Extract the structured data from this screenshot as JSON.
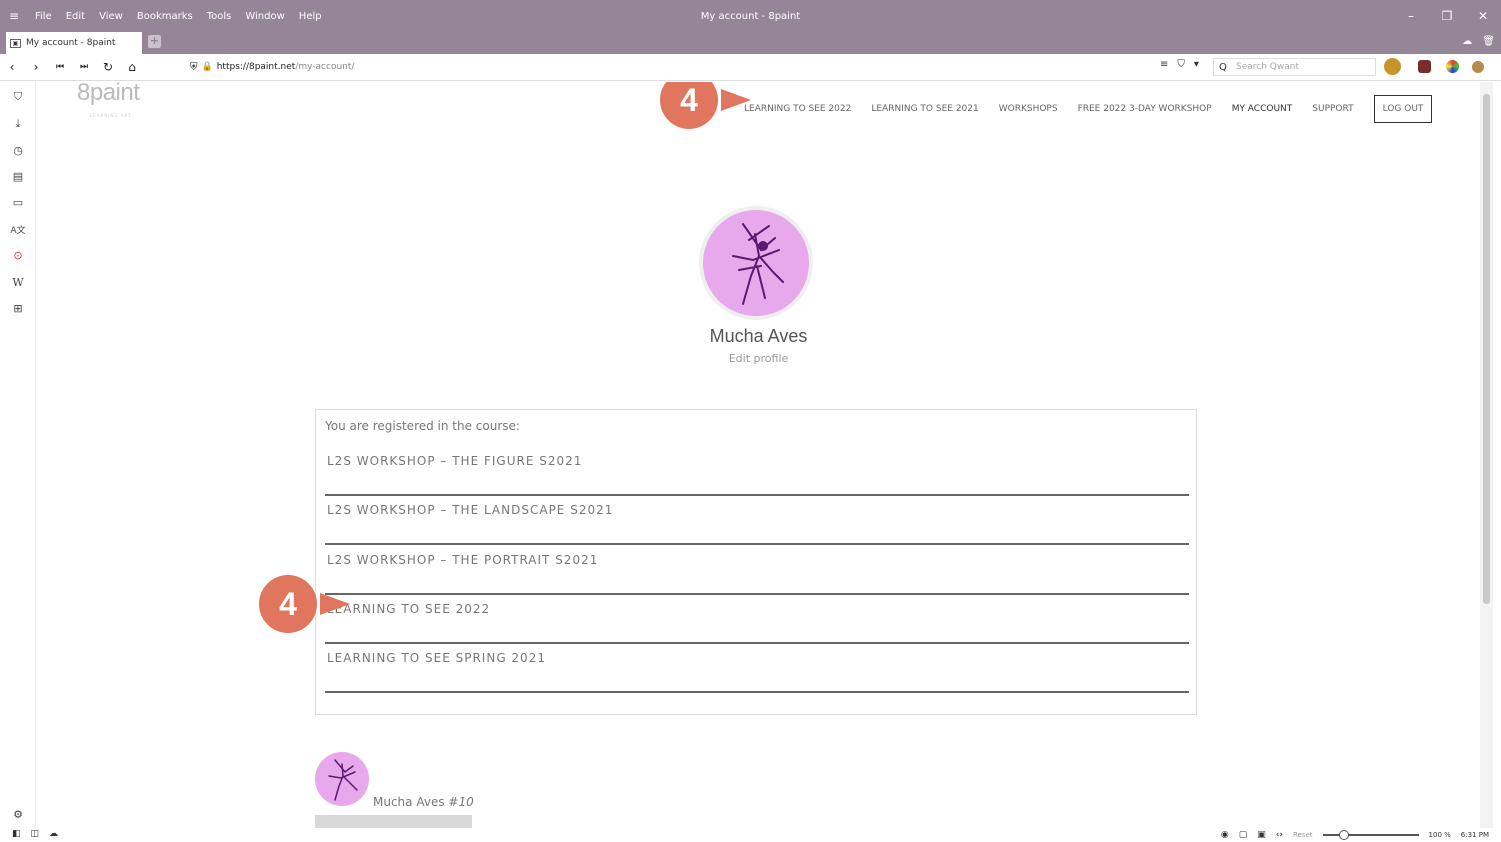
{
  "browser": {
    "menu": [
      "File",
      "Edit",
      "View",
      "Bookmarks",
      "Tools",
      "Window",
      "Help"
    ],
    "window_title": "My account - 8paint",
    "tab_label": "My account - 8paint",
    "url_host": "https://8paint.net",
    "url_path": "/my-account/",
    "search_placeholder": "Search Qwant",
    "zoom_reset": "Reset",
    "zoom_level": "100 %",
    "clock": "6:31 PM"
  },
  "site": {
    "logo": "8paint",
    "logo_sub": "LEARNING ART",
    "nav": [
      "LEARNING TO SEE 2022",
      "LEARNING TO SEE 2021",
      "WORKSHOPS",
      "FREE 2022 3-DAY WORKSHOP",
      "MY ACCOUNT",
      "SUPPORT"
    ],
    "logout": "LOG OUT"
  },
  "profile": {
    "name": "Mucha Aves",
    "edit": "Edit profile"
  },
  "courses": {
    "heading": "You are registered in the course:",
    "items": [
      "L2S WORKSHOP – THE FIGURE S2021",
      "L2S WORKSHOP – THE LANDSCAPE S2021",
      "L2S WORKSHOP – THE PORTRAIT S2021",
      "LEARNING TO SEE 2022",
      "LEARNING TO SEE SPRING 2021"
    ]
  },
  "comment": {
    "name": "Mucha Aves",
    "number": "#10"
  },
  "badges": {
    "top": "4",
    "middle": "4",
    "color": "#e0765d"
  }
}
